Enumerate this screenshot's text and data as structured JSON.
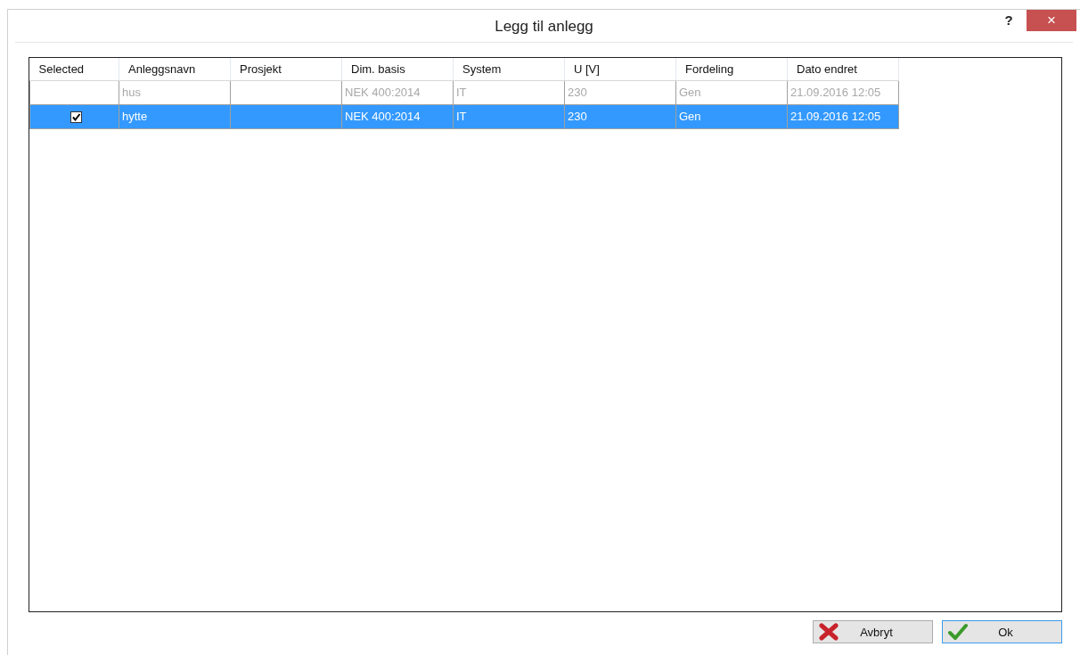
{
  "window": {
    "title": "Legg til anlegg",
    "help": "?",
    "close": "×"
  },
  "table": {
    "columns": [
      "Selected",
      "Anleggsnavn",
      "Prosjekt",
      "Dim. basis",
      "System",
      "U [V]",
      "Fordeling",
      "Dato endret"
    ],
    "rows": [
      {
        "selected": false,
        "checked": false,
        "disabled": true,
        "cells": [
          "",
          "hus",
          "",
          "NEK 400:2014",
          "IT",
          "230",
          "Gen",
          "21.09.2016 12:05"
        ]
      },
      {
        "selected": true,
        "checked": true,
        "disabled": false,
        "cells": [
          "",
          "hytte",
          "",
          "NEK 400:2014",
          "IT",
          "230",
          "Gen",
          "21.09.2016 12:05"
        ]
      }
    ]
  },
  "buttons": [
    {
      "kind": "cancel",
      "label": "Avbryt",
      "focused": false
    },
    {
      "kind": "ok",
      "label": "Ok",
      "focused": true
    }
  ]
}
